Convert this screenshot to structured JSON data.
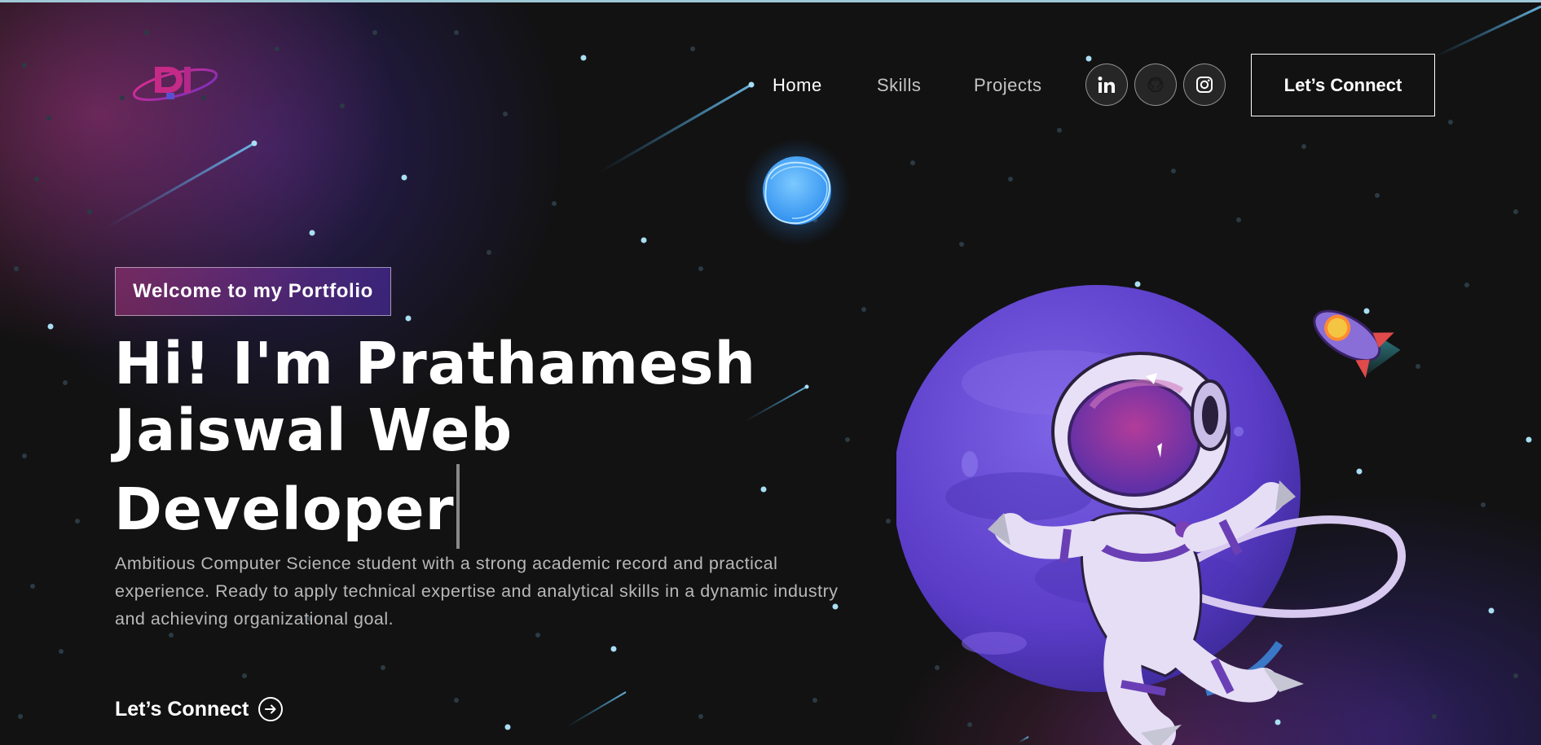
{
  "nav": {
    "links": [
      {
        "label": "Home",
        "active": true
      },
      {
        "label": "Skills",
        "active": false
      },
      {
        "label": "Projects",
        "active": false
      }
    ],
    "social": [
      {
        "icon": "linkedin-icon"
      },
      {
        "icon": "github-icon"
      },
      {
        "icon": "instagram-icon"
      }
    ],
    "connect_label": "Let’s Connect"
  },
  "hero": {
    "tagline": "Welcome to my Portfolio",
    "headline_line1": "Hi! I'm Prathamesh",
    "headline_line2": "Jaiswal Web",
    "headline_line3": "Developer",
    "description": "Ambitious Computer Science student with a strong academic record and practical experience. Ready to apply technical expertise and analytical skills in a dynamic industry and achieving organizational goal.",
    "cta_label": "Let’s Connect"
  },
  "theme": {
    "background": "#121212",
    "gradient_pink": "#AA367C",
    "gradient_purple": "#4A2FBD",
    "star_color": "#9fd6ec",
    "planet_color": "#6a4bd8"
  }
}
